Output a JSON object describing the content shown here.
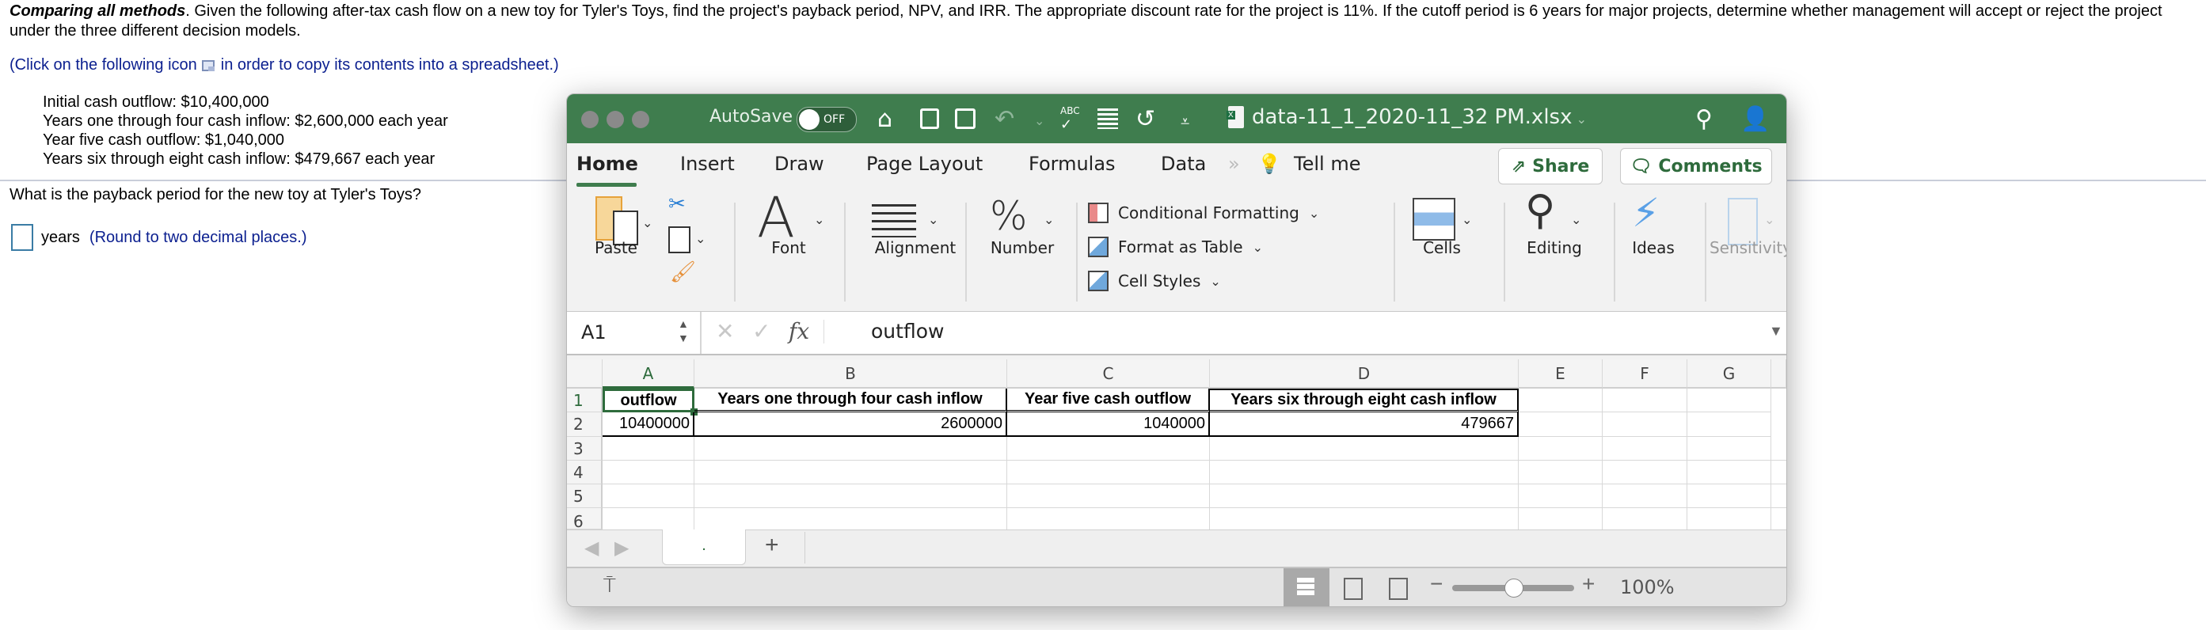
{
  "question": {
    "intro_bold": "Comparing all methods",
    "intro_text": ". Given the following after-tax cash flow on a new toy for Tyler's Toys, find the project's payback period, NPV, and IRR. The appropriate discount rate for the project is 11%. If the cutoff period is 6 years for major projects, determine whether management will accept or reject the project under the three different decision models.",
    "copy_prefix": "(Click on the following icon",
    "copy_suffix": "in order to copy its contents into a spreadsheet.)",
    "facts": [
      "Initial cash outflow: $10,400,000",
      "Years one through four cash inflow: $2,600,000 each year",
      "Year five cash outflow: $1,040,000",
      "Years six through eight cash inflow: $479,667 each year"
    ],
    "prompt": "What is the payback period for the new toy at Tyler's Toys?",
    "answer_value": "",
    "answer_unit": "years",
    "answer_hint": "(Round to two decimal places.)"
  },
  "excel": {
    "autosave_label": "AutoSave",
    "autosave_state": "OFF",
    "filename": "data-11_1_2020-11_32 PM.xlsx",
    "tabs": [
      "Home",
      "Insert",
      "Draw",
      "Page Layout",
      "Formulas",
      "Data"
    ],
    "active_tab": "Home",
    "tell_me": "Tell me",
    "share_label": "Share",
    "comments_label": "Comments",
    "ribbon": {
      "paste": "Paste",
      "font": "Font",
      "alignment": "Alignment",
      "number": "Number",
      "conditional_formatting": "Conditional Formatting",
      "format_as_table": "Format as Table",
      "cell_styles": "Cell Styles",
      "cells": "Cells",
      "editing": "Editing",
      "ideas": "Ideas",
      "sensitivity": "Sensitivity"
    },
    "name_box": "A1",
    "formula": "outflow",
    "fx": "fx",
    "columns": [
      "A",
      "B",
      "C",
      "D",
      "E",
      "F",
      "G"
    ],
    "rows": [
      "1",
      "2",
      "3",
      "4",
      "5",
      "6"
    ],
    "headers": [
      "outflow",
      "Years one through four cash inflow",
      "Year five cash outflow",
      "Years six through eight cash inflow"
    ],
    "values": [
      "10400000",
      "2600000",
      "1040000",
      "479667"
    ],
    "sheet_tab": ".",
    "add_sheet": "+",
    "zoom_level": "100%",
    "zoom_fraction": 0.5
  }
}
